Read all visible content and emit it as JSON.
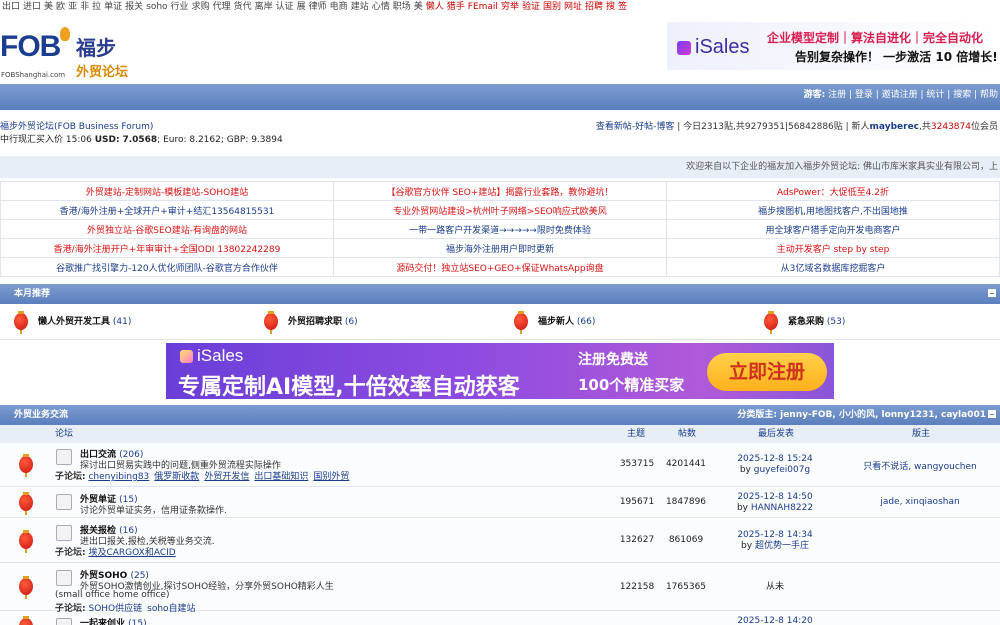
{
  "toplinks": [
    {
      "t": "出口",
      "hot": false
    },
    {
      "t": "进口",
      "hot": false
    },
    {
      "t": "美",
      "hot": false
    },
    {
      "t": "欧",
      "hot": false
    },
    {
      "t": "亚",
      "hot": false
    },
    {
      "t": "非",
      "hot": false
    },
    {
      "t": "拉",
      "hot": false
    },
    {
      "t": "单证",
      "hot": false
    },
    {
      "t": "报关",
      "hot": false
    },
    {
      "t": "soho",
      "hot": false
    },
    {
      "t": "行业",
      "hot": false
    },
    {
      "t": "求购",
      "hot": false
    },
    {
      "t": "代理",
      "hot": false
    },
    {
      "t": "货代",
      "hot": false
    },
    {
      "t": "离岸",
      "hot": false
    },
    {
      "t": "认证",
      "hot": false
    },
    {
      "t": "展",
      "hot": false
    },
    {
      "t": "律师",
      "hot": false
    },
    {
      "t": "电商",
      "hot": false
    },
    {
      "t": "建站",
      "hot": false
    },
    {
      "t": "心情",
      "hot": false
    },
    {
      "t": "职场",
      "hot": false
    },
    {
      "t": "美",
      "hot": false
    },
    {
      "t": "懒人",
      "hot": true
    },
    {
      "t": "猎手",
      "hot": true
    },
    {
      "t": "FEmail",
      "hot": true
    },
    {
      "t": "穷举",
      "hot": true
    },
    {
      "t": "验证",
      "hot": true
    },
    {
      "t": "国别",
      "hot": true
    },
    {
      "t": "网址",
      "hot": true
    },
    {
      "t": "招聘",
      "hot": true
    },
    {
      "t": "搜",
      "hot": true
    },
    {
      "t": "签",
      "hot": true
    }
  ],
  "header": {
    "logo_fob": "FOB",
    "logo_sub": "FOBShanghai.com",
    "logo_cn1": "福步",
    "logo_cn2": "外贸论坛",
    "ad_logo": "iSales",
    "ad_line1": "企业模型定制｜算法自进化｜完全自动化",
    "ad_line2": "告别复杂操作！ 一步激活 10 倍增长!"
  },
  "navbar": {
    "guest": "游客:",
    "links": [
      "注册",
      "登录",
      "邀请注册",
      "统计",
      "搜索",
      "帮助"
    ]
  },
  "info": {
    "title": "福步外贸论坛(FOB Business Forum)",
    "rate_prefix": "中行现汇买入价 15:06",
    "usd_label": "USD:",
    "usd": "7.0568",
    "eur": "; Euro: 8.2162; GBP: 9.3894",
    "right_links": "查看新帖-好帖-博客",
    "today": "| 今日2313贴,共9279351|56842886贴 | 新人",
    "newuser": "mayberec",
    "members_pre": ",共",
    "members": "3243874",
    "members_suf": "位会员"
  },
  "welcome": "欢迎来自以下企业的福友加入福步外贸论坛: 佛山市库米家具实业有限公司，上",
  "ads": [
    [
      {
        "t": "外贸建站-定制网站-模板建站-SOHO建站",
        "c": "red"
      },
      {
        "t": "【谷歌官方伙伴 SEO+建站】揭露行业套路，教你避坑！",
        "c": "red"
      },
      {
        "t": "AdsPower：大促低至4.2折",
        "c": "red"
      }
    ],
    [
      {
        "t": "香港/海外注册+全球开户+审计+结汇13564815531",
        "c": "blue"
      },
      {
        "t": "专业外贸网站建设>杭州叶子网络>SEO响应式欧美风",
        "c": "red"
      },
      {
        "t": "福步搜图机,用地图找客户,不出国地推",
        "c": "blue"
      }
    ],
    [
      {
        "t": "外贸独立站-谷歌SEO建站-有询盘的网站",
        "c": "red"
      },
      {
        "t": "一带一路客户开发渠道→→→→→限时免费体验",
        "c": "blue"
      },
      {
        "t": "用全球客户猎手定向开发电商客户",
        "c": "blue"
      }
    ],
    [
      {
        "t": "香港/海外注册开户+年审审计+全国ODI 13802242289",
        "c": "red"
      },
      {
        "t": "福步海外注册用户即时更新",
        "c": "blue"
      },
      {
        "t": "主动开发客户 step by step",
        "c": "red"
      }
    ],
    [
      {
        "t": "谷歌推广找引擎力-120人优化师团队-谷歌官方合作伙伴",
        "c": "blue"
      },
      {
        "t": "源码交付！独立站SEO+GEO+保证WhatsApp询盘",
        "c": "red"
      },
      {
        "t": "从3亿域名数据库挖掘客户",
        "c": "blue"
      }
    ]
  ],
  "monthly": {
    "title": "本月推荐",
    "items": [
      {
        "name": "懒人外贸开发工具",
        "count": "(41)"
      },
      {
        "name": "外贸招聘求职",
        "count": "(6)"
      },
      {
        "name": "福步新人",
        "count": "(66)"
      },
      {
        "name": "紧急采购",
        "count": "(53)"
      }
    ]
  },
  "bigbanner": {
    "logo": "iSales",
    "main": "专属定制AI模型,十倍效率自动获客",
    "right1": "注册免费送",
    "right2": "100个精准买家",
    "button": "立即注册"
  },
  "forum": {
    "title": "外贸业务交流",
    "mods": "分类版主: jenny-FOB, 小小的风, lonny1231, cayla001",
    "cols": {
      "forum": "论坛",
      "topics": "主题",
      "posts": "帖数",
      "last": "最后发表",
      "mods": "版主"
    },
    "rows": [
      {
        "name": "出口交流",
        "count": "(206)",
        "desc": "探讨出口贸易实践中的问题,侧重外贸流程实际操作",
        "sub_label": "子论坛:",
        "subs": [
          "chenyibing83",
          "俄罗斯收款",
          "外贸开发信",
          "出口基础知识",
          "国别外贸"
        ],
        "topics": "353715",
        "posts": "4201441",
        "last_time": "2025-12-8 15:24",
        "last_by": "guyefei007g",
        "mods": "只看不说话, wangyouchen"
      },
      {
        "name": "外贸单证",
        "count": "(15)",
        "desc": "讨论外贸单证实务，信用证条款操作.",
        "sub_label": "",
        "subs": [],
        "topics": "195671",
        "posts": "1847896",
        "last_time": "2025-12-8 14:50",
        "last_by": "HANNAH8222",
        "mods": "jade, xinqiaoshan"
      },
      {
        "name": "报关报检",
        "count": "(16)",
        "desc": "进出口报关,报检,关税等业务交流.",
        "sub_label": "子论坛:",
        "subs": [
          "埃及CARGOX和ACID"
        ],
        "topics": "132627",
        "posts": "861069",
        "last_time": "2025-12-8 14:34",
        "last_by": "超优势一手庄",
        "mods": ""
      },
      {
        "name": "外贸SOHO",
        "count": "(25)",
        "desc": "外贸SOHO激情创业,探讨SOHO经验，分享外贸SOHO精彩人生",
        "desc2": "(small office home office)",
        "sub_label": "子论坛:",
        "subs": [
          "SOHO供应链",
          "soho自建站"
        ],
        "topics": "122158",
        "posts": "1765365",
        "last_time": "",
        "last_by": "",
        "last_plain": "从未",
        "mods": ""
      },
      {
        "name": "一起来创业",
        "count": "(15)",
        "desc": "",
        "sub_label": "",
        "subs": [],
        "topics": "",
        "posts": "",
        "last_time": "2025-12-8 14:20",
        "last_by": "",
        "mods": ""
      }
    ]
  }
}
